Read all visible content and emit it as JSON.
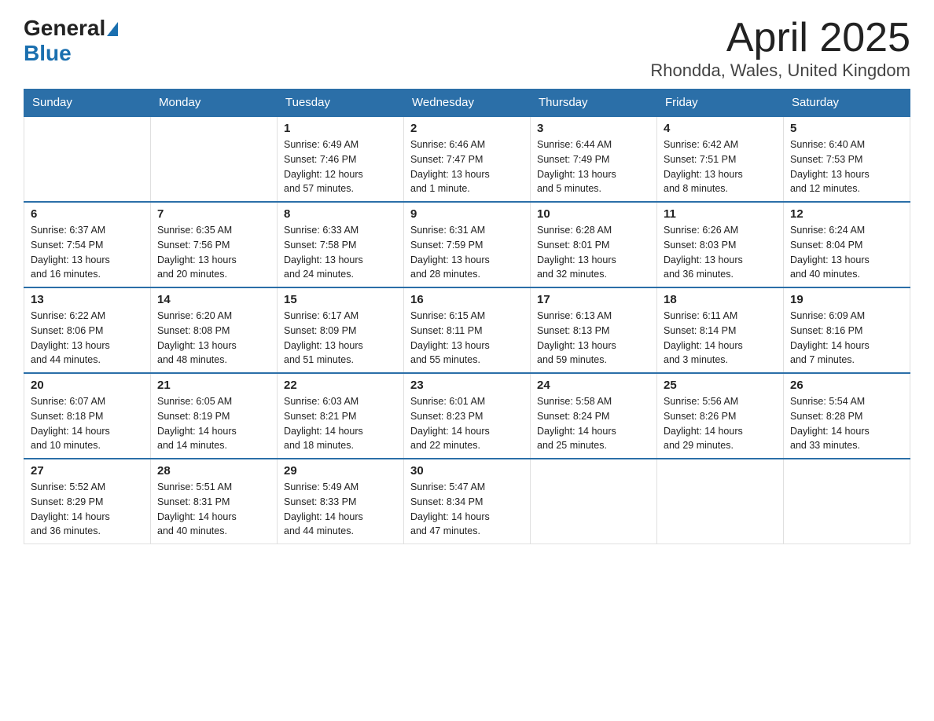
{
  "header": {
    "logo_general": "General",
    "logo_blue": "Blue",
    "title": "April 2025",
    "location": "Rhondda, Wales, United Kingdom"
  },
  "days_of_week": [
    "Sunday",
    "Monday",
    "Tuesday",
    "Wednesday",
    "Thursday",
    "Friday",
    "Saturday"
  ],
  "weeks": [
    [
      {
        "day": "",
        "info": ""
      },
      {
        "day": "",
        "info": ""
      },
      {
        "day": "1",
        "info": "Sunrise: 6:49 AM\nSunset: 7:46 PM\nDaylight: 12 hours\nand 57 minutes."
      },
      {
        "day": "2",
        "info": "Sunrise: 6:46 AM\nSunset: 7:47 PM\nDaylight: 13 hours\nand 1 minute."
      },
      {
        "day": "3",
        "info": "Sunrise: 6:44 AM\nSunset: 7:49 PM\nDaylight: 13 hours\nand 5 minutes."
      },
      {
        "day": "4",
        "info": "Sunrise: 6:42 AM\nSunset: 7:51 PM\nDaylight: 13 hours\nand 8 minutes."
      },
      {
        "day": "5",
        "info": "Sunrise: 6:40 AM\nSunset: 7:53 PM\nDaylight: 13 hours\nand 12 minutes."
      }
    ],
    [
      {
        "day": "6",
        "info": "Sunrise: 6:37 AM\nSunset: 7:54 PM\nDaylight: 13 hours\nand 16 minutes."
      },
      {
        "day": "7",
        "info": "Sunrise: 6:35 AM\nSunset: 7:56 PM\nDaylight: 13 hours\nand 20 minutes."
      },
      {
        "day": "8",
        "info": "Sunrise: 6:33 AM\nSunset: 7:58 PM\nDaylight: 13 hours\nand 24 minutes."
      },
      {
        "day": "9",
        "info": "Sunrise: 6:31 AM\nSunset: 7:59 PM\nDaylight: 13 hours\nand 28 minutes."
      },
      {
        "day": "10",
        "info": "Sunrise: 6:28 AM\nSunset: 8:01 PM\nDaylight: 13 hours\nand 32 minutes."
      },
      {
        "day": "11",
        "info": "Sunrise: 6:26 AM\nSunset: 8:03 PM\nDaylight: 13 hours\nand 36 minutes."
      },
      {
        "day": "12",
        "info": "Sunrise: 6:24 AM\nSunset: 8:04 PM\nDaylight: 13 hours\nand 40 minutes."
      }
    ],
    [
      {
        "day": "13",
        "info": "Sunrise: 6:22 AM\nSunset: 8:06 PM\nDaylight: 13 hours\nand 44 minutes."
      },
      {
        "day": "14",
        "info": "Sunrise: 6:20 AM\nSunset: 8:08 PM\nDaylight: 13 hours\nand 48 minutes."
      },
      {
        "day": "15",
        "info": "Sunrise: 6:17 AM\nSunset: 8:09 PM\nDaylight: 13 hours\nand 51 minutes."
      },
      {
        "day": "16",
        "info": "Sunrise: 6:15 AM\nSunset: 8:11 PM\nDaylight: 13 hours\nand 55 minutes."
      },
      {
        "day": "17",
        "info": "Sunrise: 6:13 AM\nSunset: 8:13 PM\nDaylight: 13 hours\nand 59 minutes."
      },
      {
        "day": "18",
        "info": "Sunrise: 6:11 AM\nSunset: 8:14 PM\nDaylight: 14 hours\nand 3 minutes."
      },
      {
        "day": "19",
        "info": "Sunrise: 6:09 AM\nSunset: 8:16 PM\nDaylight: 14 hours\nand 7 minutes."
      }
    ],
    [
      {
        "day": "20",
        "info": "Sunrise: 6:07 AM\nSunset: 8:18 PM\nDaylight: 14 hours\nand 10 minutes."
      },
      {
        "day": "21",
        "info": "Sunrise: 6:05 AM\nSunset: 8:19 PM\nDaylight: 14 hours\nand 14 minutes."
      },
      {
        "day": "22",
        "info": "Sunrise: 6:03 AM\nSunset: 8:21 PM\nDaylight: 14 hours\nand 18 minutes."
      },
      {
        "day": "23",
        "info": "Sunrise: 6:01 AM\nSunset: 8:23 PM\nDaylight: 14 hours\nand 22 minutes."
      },
      {
        "day": "24",
        "info": "Sunrise: 5:58 AM\nSunset: 8:24 PM\nDaylight: 14 hours\nand 25 minutes."
      },
      {
        "day": "25",
        "info": "Sunrise: 5:56 AM\nSunset: 8:26 PM\nDaylight: 14 hours\nand 29 minutes."
      },
      {
        "day": "26",
        "info": "Sunrise: 5:54 AM\nSunset: 8:28 PM\nDaylight: 14 hours\nand 33 minutes."
      }
    ],
    [
      {
        "day": "27",
        "info": "Sunrise: 5:52 AM\nSunset: 8:29 PM\nDaylight: 14 hours\nand 36 minutes."
      },
      {
        "day": "28",
        "info": "Sunrise: 5:51 AM\nSunset: 8:31 PM\nDaylight: 14 hours\nand 40 minutes."
      },
      {
        "day": "29",
        "info": "Sunrise: 5:49 AM\nSunset: 8:33 PM\nDaylight: 14 hours\nand 44 minutes."
      },
      {
        "day": "30",
        "info": "Sunrise: 5:47 AM\nSunset: 8:34 PM\nDaylight: 14 hours\nand 47 minutes."
      },
      {
        "day": "",
        "info": ""
      },
      {
        "day": "",
        "info": ""
      },
      {
        "day": "",
        "info": ""
      }
    ]
  ]
}
